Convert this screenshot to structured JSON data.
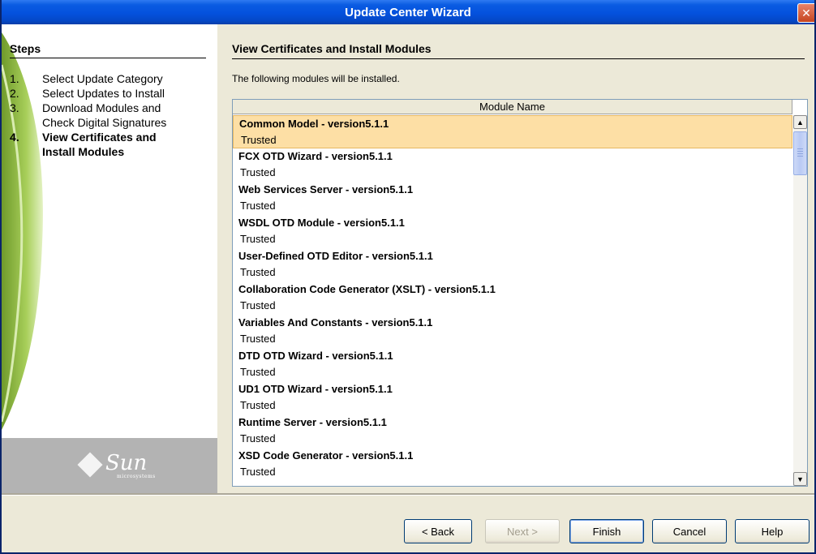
{
  "window": {
    "title": "Update Center Wizard",
    "close_glyph": "✕"
  },
  "steps": {
    "heading": "Steps",
    "items": [
      {
        "num": "1.",
        "label": "Select Update Category",
        "active": false
      },
      {
        "num": "2.",
        "label": "Select Updates to Install",
        "active": false
      },
      {
        "num": "3.",
        "label": "Download Modules and",
        "active": false
      },
      {
        "num": "",
        "label": "Check Digital Signatures",
        "active": false
      },
      {
        "num": "4.",
        "label": "View Certificates and",
        "active": true
      },
      {
        "num": "",
        "label": "Install Modules",
        "active": true
      }
    ]
  },
  "logo": {
    "word": "Sun",
    "sub": "microsystems",
    "icon": "sun-diamond-icon"
  },
  "main": {
    "title": "View Certificates and Install Modules",
    "description": "The following modules will be installed.",
    "table": {
      "column_header": "Module Name",
      "rows": [
        {
          "name": "Common Model  - version5.1.1",
          "status": "Trusted",
          "selected": true
        },
        {
          "name": "FCX OTD Wizard  - version5.1.1",
          "status": "Trusted",
          "selected": false
        },
        {
          "name": "Web Services Server  - version5.1.1",
          "status": "Trusted",
          "selected": false
        },
        {
          "name": "WSDL OTD Module  - version5.1.1",
          "status": "Trusted",
          "selected": false
        },
        {
          "name": "User-Defined OTD Editor  - version5.1.1",
          "status": "Trusted",
          "selected": false
        },
        {
          "name": "Collaboration Code Generator (XSLT)  - version5.1.1",
          "status": "Trusted",
          "selected": false
        },
        {
          "name": "Variables And Constants  - version5.1.1",
          "status": "Trusted",
          "selected": false
        },
        {
          "name": "DTD OTD Wizard  - version5.1.1",
          "status": "Trusted",
          "selected": false
        },
        {
          "name": "UD1 OTD Wizard  - version5.1.1",
          "status": "Trusted",
          "selected": false
        },
        {
          "name": "Runtime Server  - version5.1.1",
          "status": "Trusted",
          "selected": false
        },
        {
          "name": "XSD Code Generator  - version5.1.1",
          "status": "Trusted",
          "selected": false
        }
      ]
    },
    "scroll": {
      "up_glyph": "▲",
      "down_glyph": "▼"
    }
  },
  "buttons": {
    "back": "< Back",
    "next": "Next >",
    "finish": "Finish",
    "cancel": "Cancel",
    "help": "Help"
  },
  "colors": {
    "titlebar": "#0451dd",
    "selection": "#fddfa5",
    "window_bg": "#ece9d8"
  }
}
